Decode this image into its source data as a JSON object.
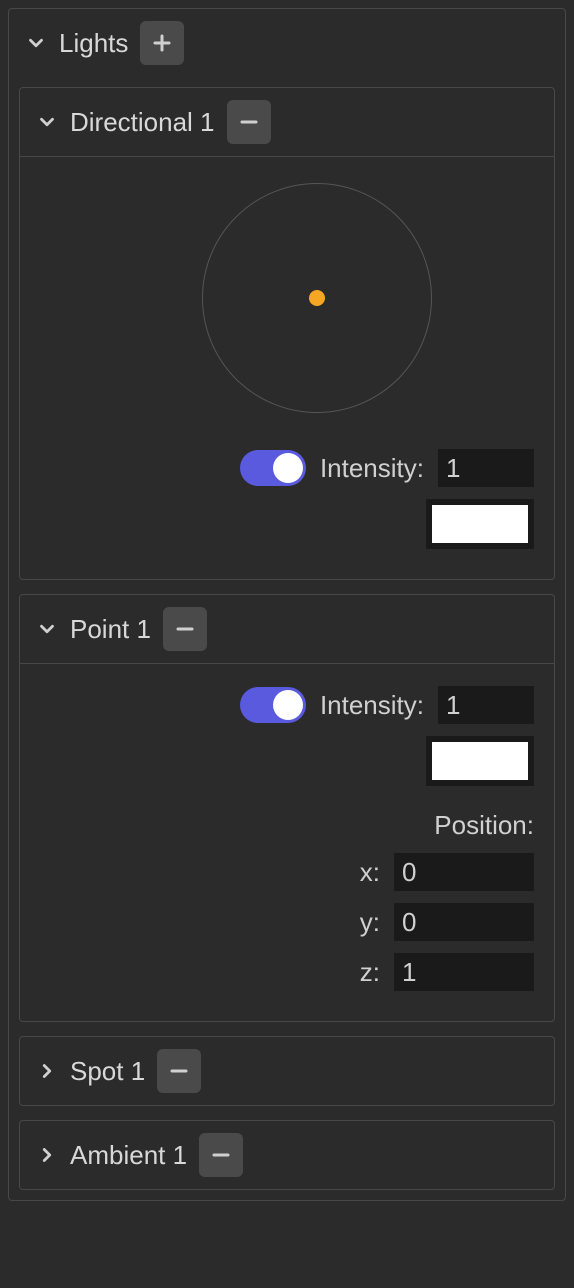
{
  "panel": {
    "title": "Lights",
    "expanded": true
  },
  "lights": [
    {
      "expanded": true,
      "title": "Directional 1",
      "intensity_label": "Intensity:",
      "intensity_value": "1",
      "enabled": true,
      "color": "#ffffff",
      "has_direction_widget": true,
      "has_position": false
    },
    {
      "expanded": true,
      "title": "Point 1",
      "intensity_label": "Intensity:",
      "intensity_value": "1",
      "enabled": true,
      "color": "#ffffff",
      "has_direction_widget": false,
      "has_position": true,
      "position_label": "Position:",
      "position": {
        "x_label": "x:",
        "x": "0",
        "y_label": "y:",
        "y": "0",
        "z_label": "z:",
        "z": "1"
      }
    },
    {
      "expanded": false,
      "title": "Spot 1"
    },
    {
      "expanded": false,
      "title": "Ambient 1"
    }
  ]
}
